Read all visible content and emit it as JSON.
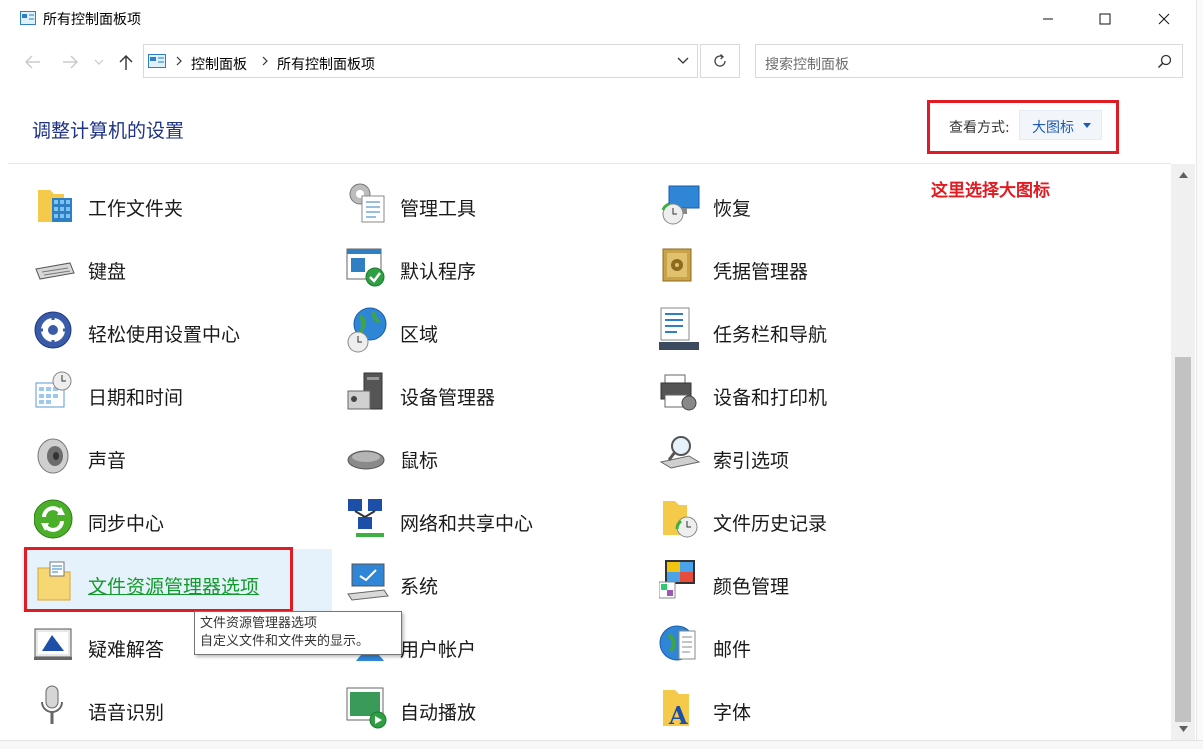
{
  "window": {
    "title": "所有控制面板项"
  },
  "nav": {
    "breadcrumb": [
      "控制面板",
      "所有控制面板项"
    ],
    "search_placeholder": "搜索控制面板"
  },
  "header": {
    "heading": "调整计算机的设置",
    "view_label": "查看方式:",
    "view_value": "大图标"
  },
  "annotation": {
    "note": "这里选择大图标"
  },
  "items": [
    [
      "工作文件夹",
      "管理工具",
      "恢复"
    ],
    [
      "键盘",
      "默认程序",
      "凭据管理器"
    ],
    [
      "轻松使用设置中心",
      "区域",
      "任务栏和导航"
    ],
    [
      "日期和时间",
      "设备管理器",
      "设备和打印机"
    ],
    [
      "声音",
      "鼠标",
      "索引选项"
    ],
    [
      "同步中心",
      "网络和共享中心",
      "文件历史记录"
    ],
    [
      "文件资源管理器选项",
      "系统",
      "颜色管理"
    ],
    [
      "疑难解答",
      "用户帐户",
      "邮件"
    ],
    [
      "语音识别",
      "自动播放",
      "字体"
    ]
  ],
  "tooltip": {
    "line1": "文件资源管理器选项",
    "line2": "自定义文件和文件夹的显示。"
  },
  "colors": {
    "heading": "#1e3287",
    "accent": "#1e5bb5",
    "annotation_red": "#e11b22",
    "hover_green": "#139a2c"
  }
}
